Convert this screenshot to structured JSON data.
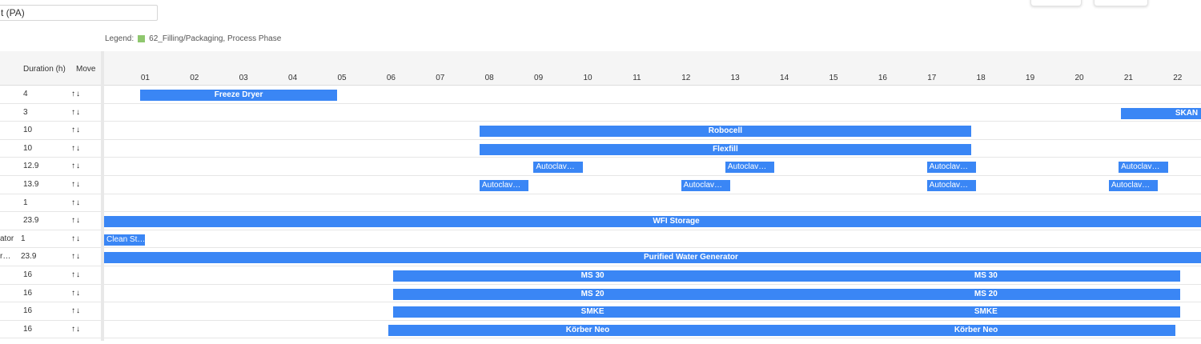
{
  "field": {
    "value": "t (PA)"
  },
  "legend": {
    "label": "Legend:",
    "item": "62_Filling/Packaging, Process Phase",
    "color": "#8fc76e"
  },
  "columns": {
    "duration": "Duration (h)",
    "move": "Move"
  },
  "ticks": [
    "01",
    "02",
    "03",
    "04",
    "05",
    "06",
    "07",
    "08",
    "09",
    "10",
    "11",
    "12",
    "13",
    "14",
    "15",
    "16",
    "17",
    "18",
    "19",
    "20",
    "21",
    "22"
  ],
  "bar_color": "#3a86f5",
  "rows": [
    {
      "name": "",
      "duration": "4",
      "bars": [
        {
          "start": 0.9,
          "end": 4.9,
          "label": "Freeze Dryer"
        }
      ]
    },
    {
      "name": "",
      "duration": "3",
      "bars": [
        {
          "start": 20.85,
          "end": 23.85,
          "label": "SKAN"
        }
      ]
    },
    {
      "name": "",
      "duration": "10",
      "bars": [
        {
          "start": 7.8,
          "end": 17.8,
          "label": "Robocell"
        }
      ]
    },
    {
      "name": "",
      "duration": "10",
      "bars": [
        {
          "start": 7.8,
          "end": 17.8,
          "label": "Flexfill"
        }
      ]
    },
    {
      "name": "",
      "duration": "12.9",
      "bars": [
        {
          "start": 8.9,
          "end": 9.9,
          "label": "Autoclav…",
          "align": "left"
        },
        {
          "start": 12.8,
          "end": 13.8,
          "label": "Autoclav…",
          "align": "left"
        },
        {
          "start": 16.9,
          "end": 17.9,
          "label": "Autoclav…",
          "align": "left"
        },
        {
          "start": 20.8,
          "end": 21.8,
          "label": "Autoclav…",
          "align": "left"
        }
      ]
    },
    {
      "name": "",
      "duration": "13.9",
      "bars": [
        {
          "start": 7.8,
          "end": 8.8,
          "label": "Autoclav…",
          "align": "left"
        },
        {
          "start": 11.9,
          "end": 12.9,
          "label": "Autoclav…",
          "align": "left"
        },
        {
          "start": 16.9,
          "end": 17.9,
          "label": "Autoclav…",
          "align": "left"
        },
        {
          "start": 20.6,
          "end": 21.6,
          "label": "Autoclav…",
          "align": "left"
        }
      ]
    },
    {
      "name": "",
      "duration": "1",
      "bars": []
    },
    {
      "name": "",
      "duration": "23.9",
      "bars": [
        {
          "start": 0,
          "end": 24,
          "label": "WFI Storage",
          "labelAt": 11.8
        }
      ]
    },
    {
      "name": "ator",
      "duration": "1",
      "bars": [
        {
          "start": 0,
          "end": 1,
          "label": "Clean St…",
          "align": "left"
        }
      ]
    },
    {
      "name": "r…",
      "duration": "23.9",
      "bars": [
        {
          "start": 0,
          "end": 24,
          "label": "Purified Water Generator",
          "labelAt": 12.1
        }
      ]
    },
    {
      "name": "",
      "duration": "16",
      "bars": [
        {
          "start": 6.05,
          "end": 22.05,
          "labels": [
            {
              "text": "MS 30",
              "at": 10.1
            },
            {
              "text": "MS 30",
              "at": 18.1
            }
          ]
        }
      ]
    },
    {
      "name": "",
      "duration": "16",
      "bars": [
        {
          "start": 6.05,
          "end": 22.05,
          "labels": [
            {
              "text": "MS 20",
              "at": 10.1
            },
            {
              "text": "MS 20",
              "at": 18.1
            }
          ]
        }
      ]
    },
    {
      "name": "",
      "duration": "16",
      "bars": [
        {
          "start": 6.05,
          "end": 22.05,
          "labels": [
            {
              "text": "SMKE",
              "at": 10.1
            },
            {
              "text": "SMKE",
              "at": 18.1
            }
          ]
        }
      ]
    },
    {
      "name": "",
      "duration": "16",
      "bars": [
        {
          "start": 5.95,
          "end": 21.95,
          "labels": [
            {
              "text": "Körber Neo",
              "at": 10.0
            },
            {
              "text": "Körber Neo",
              "at": 17.9
            }
          ]
        }
      ]
    }
  ]
}
